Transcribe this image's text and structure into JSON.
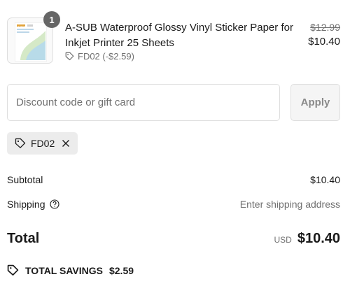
{
  "product": {
    "quantity": "1",
    "title": "A-SUB Waterproof Glossy Vinyl Sticker Paper for Inkjet Printer 25 Sheets",
    "discount_line": "FD02 (-$2.59)",
    "original_price": "$12.99",
    "price": "$10.40",
    "thumbnail_brand": "A-SUB"
  },
  "discount": {
    "placeholder": "Discount code or gift card",
    "value": "",
    "apply_label": "Apply",
    "applied_code": "FD02"
  },
  "summary": {
    "subtotal_label": "Subtotal",
    "subtotal_value": "$10.40",
    "shipping_label": "Shipping",
    "shipping_value": "Enter shipping address",
    "total_label": "Total",
    "currency": "USD",
    "total_value": "$10.40",
    "savings_label": "TOTAL SAVINGS",
    "savings_value": "$2.59"
  },
  "colors": {
    "text": "#1a1a1a",
    "muted": "#707070",
    "border": "#dedede",
    "badge": "#666666",
    "chip_bg": "#ececec"
  }
}
